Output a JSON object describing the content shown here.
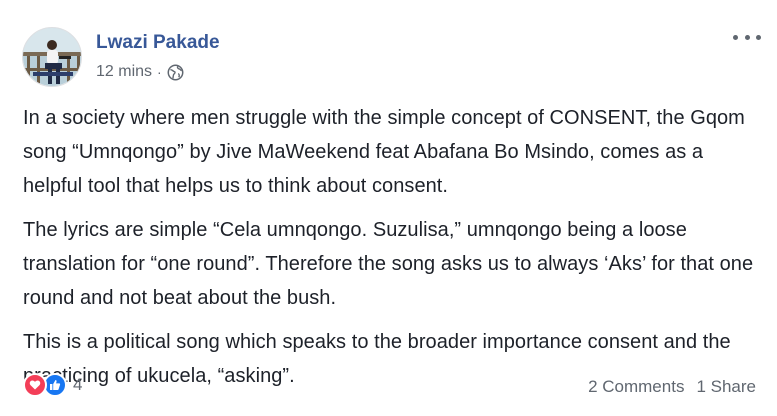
{
  "post": {
    "author": "Lwazi Pakade",
    "timestamp": "12 mins",
    "separator": "·",
    "privacy_icon": "globe-icon",
    "paragraphs": [
      "In a society where men struggle with the simple concept of CONSENT, the Gqom song “Umnqongo” by Jive MaWeekend feat Abafana Bo Msindo, comes as a helpful tool that helps us to think about consent.",
      "The lyrics are simple “Cela umnqongo. Suzulisa,” umnqongo being a loose translation for “one round”. Therefore the song asks us to always ‘Aks’ for that one round and not beat about the bush.",
      "This is a political song which speaks to the broader importance consent and the practicing of ukucela, “asking”."
    ]
  },
  "footer": {
    "reaction_icons": [
      "love-icon",
      "like-icon"
    ],
    "reaction_count": "4",
    "comments": "2 Comments",
    "shares": "1 Share"
  },
  "colors": {
    "author": "#385898",
    "text": "#1d2129",
    "muted": "#606770",
    "love": "#f33e58",
    "like": "#1877f2"
  }
}
